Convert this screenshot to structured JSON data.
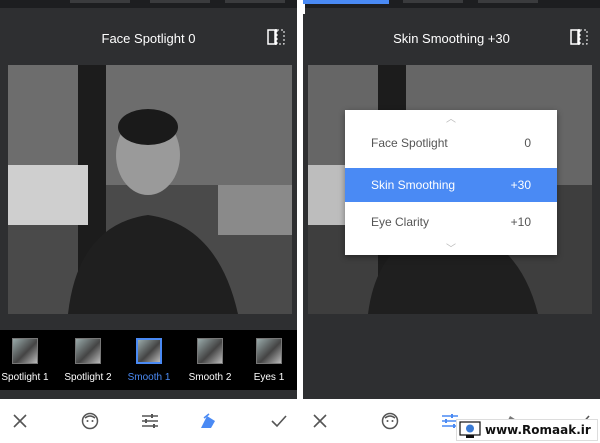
{
  "left": {
    "title": "Face Spotlight 0",
    "thumbnails": [
      {
        "label": "Spotlight 1",
        "selected": false
      },
      {
        "label": "Spotlight 2",
        "selected": false
      },
      {
        "label": "Smooth 1",
        "selected": true
      },
      {
        "label": "Smooth 2",
        "selected": false
      },
      {
        "label": "Eyes 1",
        "selected": false
      }
    ],
    "toolbar": [
      "close-icon",
      "face-icon",
      "sliders-icon",
      "styles-icon",
      "check-icon"
    ]
  },
  "right": {
    "title": "Skin Smoothing +30",
    "menu": [
      {
        "name": "Face Spotlight",
        "value": "0",
        "active": false
      },
      {
        "name": "Skin Smoothing",
        "value": "+30",
        "active": true
      },
      {
        "name": "Eye Clarity",
        "value": "+10",
        "active": false
      }
    ],
    "toolbar": [
      "close-icon",
      "face-icon",
      "sliders-icon",
      "styles-icon",
      "check-icon"
    ]
  },
  "watermark": {
    "text": "www.Romaak.ir"
  },
  "colors": {
    "accent": "#4a8af4",
    "panel": "#2e2f31",
    "toolbar": "#ffffff"
  }
}
